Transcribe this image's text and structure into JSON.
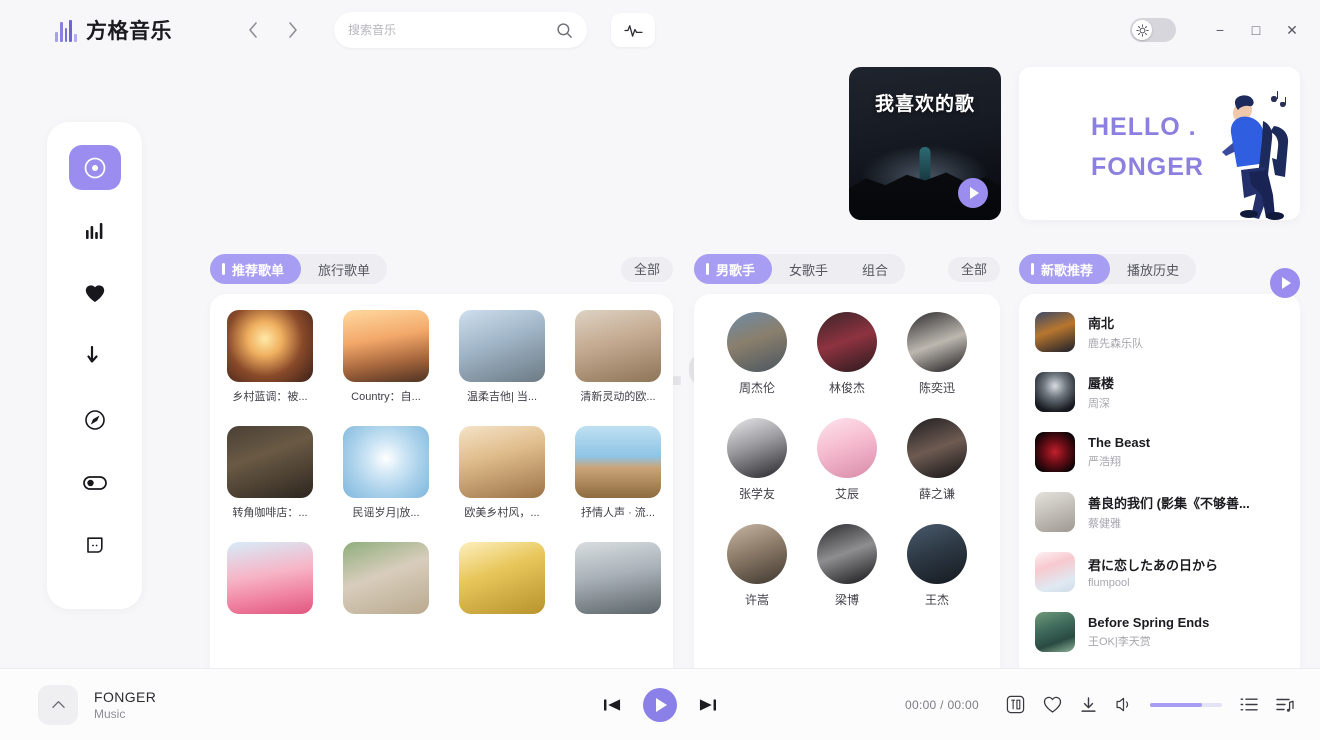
{
  "app": {
    "brand": "方格音乐",
    "logo_icon": "equalizer-logo-icon"
  },
  "header": {
    "back_icon": "chevron-left-icon",
    "forward_icon": "chevron-right-icon",
    "search": {
      "placeholder": "搜索音乐",
      "value": "",
      "icon": "search-icon"
    },
    "eq_icon": "audio-wave-icon",
    "theme_toggle_icon": "sun-icon",
    "minimize_label": "−",
    "maximize_label": "□",
    "close_label": "✕"
  },
  "sidebar": {
    "items": [
      {
        "name": "discover",
        "icon": "disc-icon",
        "active": true
      },
      {
        "name": "charts",
        "icon": "bar-chart-icon",
        "active": false
      },
      {
        "name": "favorites",
        "icon": "heart-icon",
        "active": false
      },
      {
        "name": "downloads",
        "icon": "download-arrow-icon",
        "active": false
      },
      {
        "name": "radio",
        "icon": "compass-icon",
        "active": false
      },
      {
        "name": "toggle-settings",
        "icon": "toggle-switch-icon",
        "active": false
      },
      {
        "name": "messages",
        "icon": "chat-bubble-icon",
        "active": false
      }
    ]
  },
  "banners": {
    "favorite": {
      "title": "我喜欢的歌",
      "play_icon": "play-icon"
    },
    "hello": {
      "line1": "HELLO .",
      "line2": "FONGER",
      "illustration": "walking-person-illustration"
    }
  },
  "watermark": "20.com",
  "playlists": {
    "tabs": [
      {
        "label": "推荐歌单",
        "active": true
      },
      {
        "label": "旅行歌单",
        "active": false
      }
    ],
    "all_label": "全部",
    "items": [
      {
        "label": "乡村蓝调：被...",
        "thumb": "t1"
      },
      {
        "label": "Country：自...",
        "thumb": "t2"
      },
      {
        "label": "温柔吉他| 当...",
        "thumb": "t3"
      },
      {
        "label": "清新灵动的欧...",
        "thumb": "t4"
      },
      {
        "label": "转角咖啡店：...",
        "thumb": "t5"
      },
      {
        "label": "民谣岁月|放...",
        "thumb": "t6"
      },
      {
        "label": "欧美乡村风，...",
        "thumb": "t7"
      },
      {
        "label": "抒情人声 · 流...",
        "thumb": "t8"
      },
      {
        "label": "",
        "thumb": "t9"
      },
      {
        "label": "",
        "thumb": "t10"
      },
      {
        "label": "",
        "thumb": "t11"
      },
      {
        "label": "",
        "thumb": "t12"
      }
    ]
  },
  "artists": {
    "tabs": [
      {
        "label": "男歌手",
        "active": true
      },
      {
        "label": "女歌手",
        "active": false
      },
      {
        "label": "组合",
        "active": false
      }
    ],
    "all_label": "全部",
    "items": [
      {
        "name": "周杰伦",
        "avatar": "a1"
      },
      {
        "name": "林俊杰",
        "avatar": "a2"
      },
      {
        "name": "陈奕迅",
        "avatar": "a3"
      },
      {
        "name": "张学友",
        "avatar": "a4"
      },
      {
        "name": "艾辰",
        "avatar": "a5"
      },
      {
        "name": "薛之谦",
        "avatar": "a6"
      },
      {
        "name": "许嵩",
        "avatar": "a7"
      },
      {
        "name": "梁博",
        "avatar": "a8"
      },
      {
        "name": "王杰",
        "avatar": "a9"
      }
    ]
  },
  "newsongs": {
    "tabs": [
      {
        "label": "新歌推荐",
        "active": true
      },
      {
        "label": "播放历史",
        "active": false
      }
    ],
    "play_all_icon": "play-icon",
    "items": [
      {
        "title": "南北",
        "artist": "鹿先森乐队",
        "thumb": "s1"
      },
      {
        "title": "蜃楼",
        "artist": "周深",
        "thumb": "s2"
      },
      {
        "title": "The Beast",
        "artist": "严浩翔",
        "thumb": "s3"
      },
      {
        "title": "善良的我们 (影集《不够善...",
        "artist": "蔡健雅",
        "thumb": "s4"
      },
      {
        "title": "君に恋したあの日から",
        "artist": "flumpool",
        "thumb": "s5"
      },
      {
        "title": "Before Spring Ends",
        "artist": "王OK|李天赏",
        "thumb": "s6"
      }
    ]
  },
  "player": {
    "expand_icon": "chevron-up-icon",
    "track_title": "FONGER",
    "track_sub": "Music",
    "prev_icon": "previous-track-icon",
    "play_icon": "play-icon",
    "next_icon": "next-track-icon",
    "current_time": "00:00",
    "separator": "/",
    "total_time": "00:00",
    "icons": {
      "lyrics": "lyrics-icon",
      "like": "heart-outline-icon",
      "download": "download-icon",
      "volume": "volume-icon",
      "queue": "list-icon",
      "playlist": "playlist-music-icon"
    },
    "volume_percent": 72
  },
  "colors": {
    "accent": "#8b7fe8",
    "accent_light": "#a79df2",
    "bg": "#f7f7f9",
    "card": "#ffffff"
  }
}
